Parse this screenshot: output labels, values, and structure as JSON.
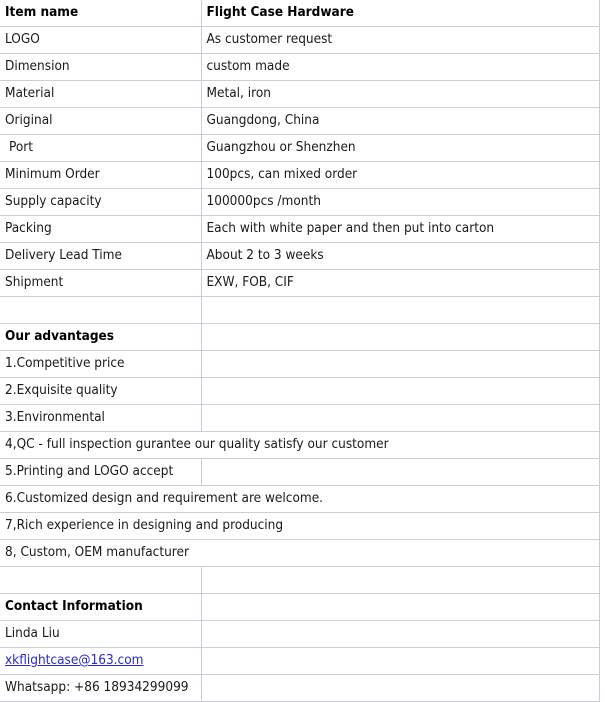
{
  "table": {
    "header": {
      "label": "Item name",
      "value": "Flight Case Hardware"
    },
    "rows": [
      {
        "label": "LOGO",
        "value": "As customer request",
        "bold": false,
        "overflow": false,
        "indent": false
      },
      {
        "label": "Dimension",
        "value": "custom made",
        "bold": false,
        "overflow": false,
        "indent": false
      },
      {
        "label": "Material",
        "value": "Metal, iron",
        "bold": false,
        "overflow": false,
        "indent": false
      },
      {
        "label": "Original",
        "value": "Guangdong, China",
        "bold": false,
        "overflow": false,
        "indent": false
      },
      {
        "label": " Port",
        "value": "Guangzhou or Shenzhen",
        "bold": false,
        "overflow": false,
        "indent": true
      },
      {
        "label": "Minimum Order",
        "value": "100pcs, can mixed order",
        "bold": false,
        "overflow": false,
        "indent": false
      },
      {
        "label": "Supply capacity",
        "value": "100000pcs /month",
        "bold": false,
        "overflow": false,
        "indent": false
      },
      {
        "label": "Packing",
        "value": "Each with white paper and then put into carton",
        "bold": false,
        "overflow": false,
        "indent": false
      },
      {
        "label": "Delivery Lead Time",
        "value": "About 2 to 3 weeks",
        "bold": false,
        "overflow": false,
        "indent": false
      },
      {
        "label": "Shipment",
        "value": "EXW, FOB, CIF",
        "bold": false,
        "overflow": false,
        "indent": false
      },
      {
        "label": "",
        "value": "",
        "bold": false,
        "overflow": false,
        "indent": false
      },
      {
        "label": "Our advantages",
        "value": "",
        "bold": true,
        "overflow": false,
        "indent": false
      },
      {
        "label": "1.Competitive price",
        "value": "",
        "bold": false,
        "overflow": false,
        "indent": false
      },
      {
        "label": "2.Exquisite quality",
        "value": "",
        "bold": false,
        "overflow": false,
        "indent": false
      },
      {
        "label": "3.Environmental",
        "value": "",
        "bold": false,
        "overflow": false,
        "indent": false
      },
      {
        "label": "4,QC - full inspection gurantee our quality satisfy our customer",
        "value": "",
        "bold": false,
        "overflow": true,
        "indent": false
      },
      {
        "label": "5.Printing and LOGO accept",
        "value": "",
        "bold": false,
        "overflow": false,
        "indent": false
      },
      {
        "label": "6.Customized design and requirement are welcome.",
        "value": "",
        "bold": false,
        "overflow": true,
        "indent": false
      },
      {
        "label": "7,Rich experience in designing and producing",
        "value": "",
        "bold": false,
        "overflow": true,
        "indent": false
      },
      {
        "label": "8, Custom, OEM manufacturer",
        "value": "",
        "bold": false,
        "overflow": true,
        "indent": false
      },
      {
        "label": "",
        "value": "",
        "bold": false,
        "overflow": false,
        "indent": false
      },
      {
        "label": "Contact Information",
        "value": "",
        "bold": true,
        "overflow": false,
        "indent": false
      },
      {
        "label": "Linda Liu",
        "value": "",
        "bold": false,
        "overflow": false,
        "indent": false
      },
      {
        "label": "xkflightcase@163.com",
        "value": "",
        "bold": false,
        "overflow": false,
        "indent": false,
        "link": true
      },
      {
        "label": "Whatsapp: +86 18934299099",
        "value": "",
        "bold": false,
        "overflow": false,
        "indent": false
      }
    ]
  },
  "colors": {
    "gridline": "#c9cfda",
    "text": "#1a1a1a",
    "link": "#2a2aca",
    "background": "#ffffff"
  }
}
